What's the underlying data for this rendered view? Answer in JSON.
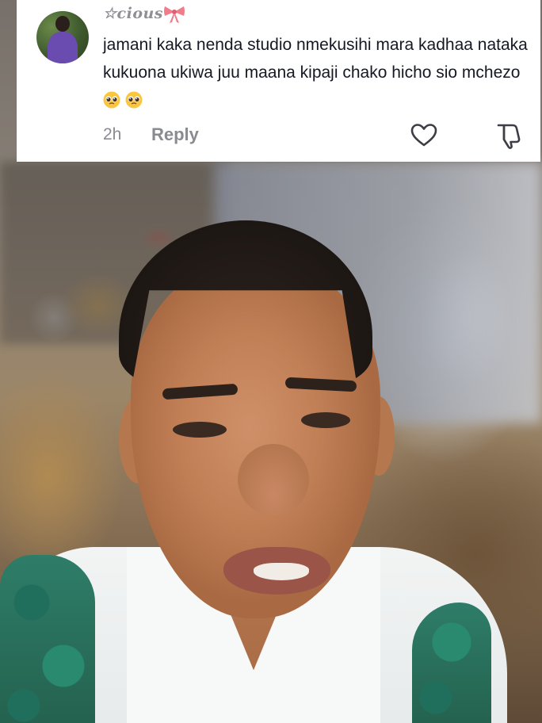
{
  "comment": {
    "username": "☆cious",
    "username_icon": "bow-icon",
    "text": "jamani kaka nenda studio nmekusihi mara kadhaa nataka kukuona ukiwa juu maana kipaji chako hicho sio mchezo",
    "trailing_emojis": [
      "pleading-face-icon",
      "pleading-face-icon"
    ],
    "time": "2h",
    "reply_label": "Reply",
    "like_icon": "heart-outline-icon",
    "dislike_icon": "thumbs-down-outline-icon"
  },
  "colors": {
    "card_background": "#ffffff",
    "primary_text": "#161823",
    "secondary_text": "#8a8b91",
    "bow_color": "#f07c8a"
  }
}
